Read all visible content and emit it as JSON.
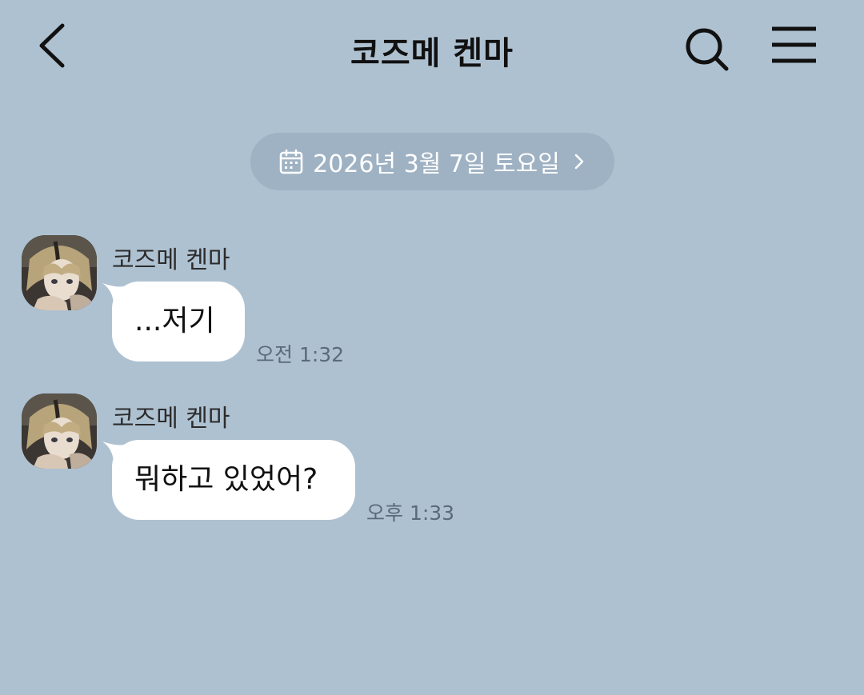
{
  "header": {
    "title": "코즈메 켄마"
  },
  "date_divider": {
    "label": "2026년 3월 7일 토요일"
  },
  "messages": [
    {
      "sender": "코즈메 켄마",
      "text": "...저기",
      "time": "오전 1:32"
    },
    {
      "sender": "코즈메 켄마",
      "text": "뭐하고 있었어?",
      "time": "오후 1:33"
    }
  ],
  "colors": {
    "background": "#aec1d1",
    "pill": "#9fb2c3",
    "bubble": "#ffffff",
    "time_text": "#5a6a7a"
  },
  "icons": {
    "back": "chevron-left-icon",
    "search": "search-icon",
    "menu": "hamburger-menu-icon",
    "calendar": "calendar-icon",
    "date_arrow": "chevron-right-icon"
  }
}
